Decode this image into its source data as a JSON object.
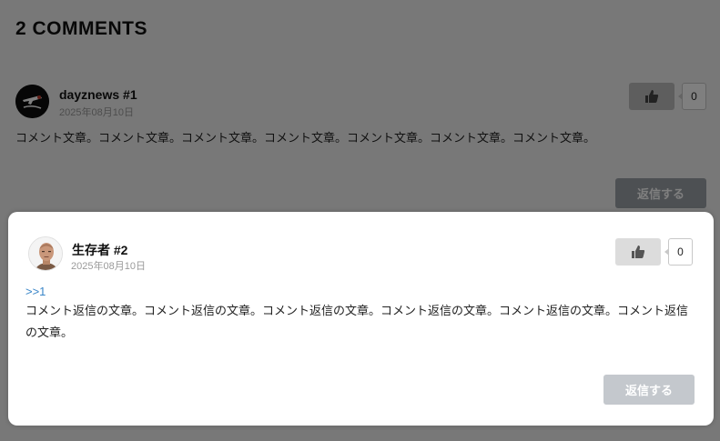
{
  "section": {
    "title": "2 COMMENTS"
  },
  "comments": [
    {
      "author": "dayznews #1",
      "date": "2025年08月10日",
      "likes": "0",
      "text": "コメント文章。コメント文章。コメント文章。コメント文章。コメント文章。コメント文章。コメント文章。",
      "reply_label": "返信する"
    },
    {
      "author": "生存者 #2",
      "date": "2025年08月10日",
      "likes": "0",
      "quote": ">>1",
      "text": "コメント返信の文章。コメント返信の文章。コメント返信の文章。コメント返信の文章。コメント返信の文章。コメント返信の文章。",
      "reply_label": "返信する"
    }
  ],
  "icons": {
    "like": "thumbs-up-icon"
  },
  "colors": {
    "link": "#3a86c8",
    "reply_button": "#c4c8cd",
    "like_button": "#dcdcdc"
  }
}
